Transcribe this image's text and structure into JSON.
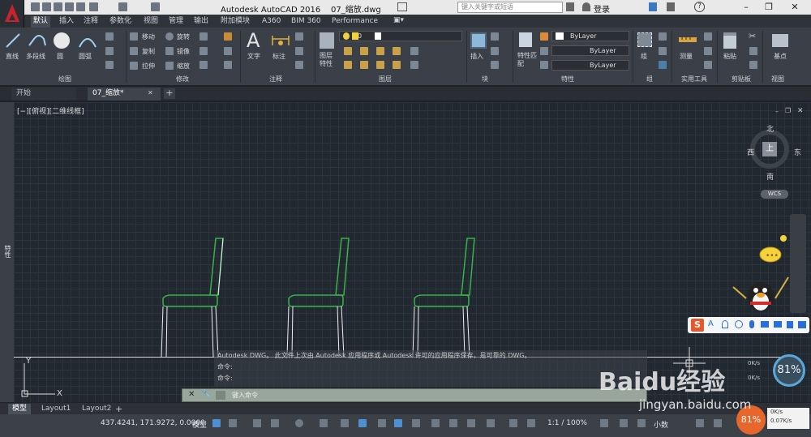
{
  "titlebar": {
    "title": "Autodesk AutoCAD 2016    07_缩放.dwg",
    "search_placeholder": "键入关键字或短语",
    "login": "登录"
  },
  "ribbon_tabs": [
    "默认",
    "插入",
    "注释",
    "参数化",
    "视图",
    "管理",
    "输出",
    "附加模块",
    "A360",
    "BIM 360",
    "Performance"
  ],
  "ribbon": {
    "draw_tools": [
      "直线",
      "多段线",
      "圆",
      "圆弧"
    ],
    "modify_tools": [
      "移动",
      "旋转",
      "复制",
      "镜像",
      "拉伸",
      "缩放"
    ],
    "annotation_tools": [
      "文字",
      "标注"
    ],
    "layer_props": "图层特性",
    "layer_current": "0",
    "insert": "插入",
    "match_props": "特性匹配",
    "bylayer_color": "ByLayer",
    "bylayer_linetype": "ByLayer",
    "bylayer_lineweight": "ByLayer",
    "group": "组",
    "measure": "测量",
    "paste": "粘贴",
    "basepoint": "基点",
    "panels": [
      "绘图",
      "修改",
      "注释",
      "图层",
      "块",
      "特性",
      "组",
      "实用工具",
      "剪贴板",
      "视图"
    ]
  },
  "doc_tabs": [
    "开始",
    "07_缩放*"
  ],
  "viewport_label": "[−][俯视][二维线框]",
  "viewcube": {
    "north": "北",
    "south": "南",
    "east": "东",
    "west": "西",
    "face": "上",
    "wcs": "WCS"
  },
  "left_palette": "特性",
  "command": {
    "history": [
      "Autodesk DWG。  此文件上次由 Autodesk 应用程序或 Autodesk 许可的应用程序保存，是可靠的 DWG。",
      "命令:",
      "命令:"
    ],
    "input_placeholder": "键入命令"
  },
  "layout_tabs": [
    "模型",
    "Layout1",
    "Layout2"
  ],
  "statusbar": {
    "coords": "437.4241, 171.9272, 0.0000",
    "space": "模型",
    "scale": "1:1 / 100%",
    "units": "小数"
  },
  "overlays": {
    "speed_percent": "81%",
    "net_up": "0K/s",
    "net_down": "0.07K/s",
    "watermark": "Baidu经验",
    "watermark_url": "jingyan.baidu.com"
  },
  "colors": {
    "chair_seat": "#39b24a",
    "chair_frame": "#f0f0f0",
    "accent_red": "#c8232c"
  }
}
